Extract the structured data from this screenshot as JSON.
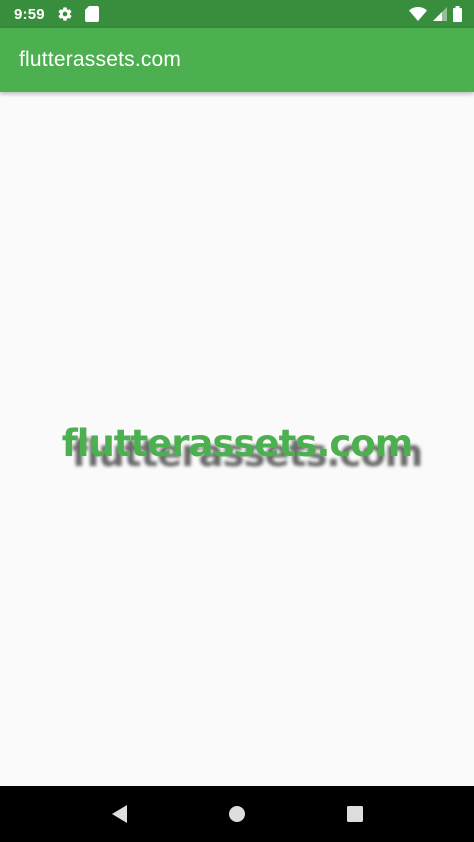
{
  "status_bar": {
    "time": "9:59",
    "icons_left": [
      "gear-icon",
      "sd-card-icon"
    ],
    "icons_right": [
      "wifi-icon",
      "signal-icon",
      "battery-icon"
    ],
    "color": "#388e3c"
  },
  "app_bar": {
    "title": "flutterassets.com",
    "color": "#4caf50"
  },
  "content": {
    "headline": "flutterassets.com",
    "headline_color": "#4caf50",
    "shadow_color": "#464646"
  },
  "nav_bar": {
    "buttons": [
      "back-icon",
      "home-icon",
      "recents-icon"
    ]
  }
}
